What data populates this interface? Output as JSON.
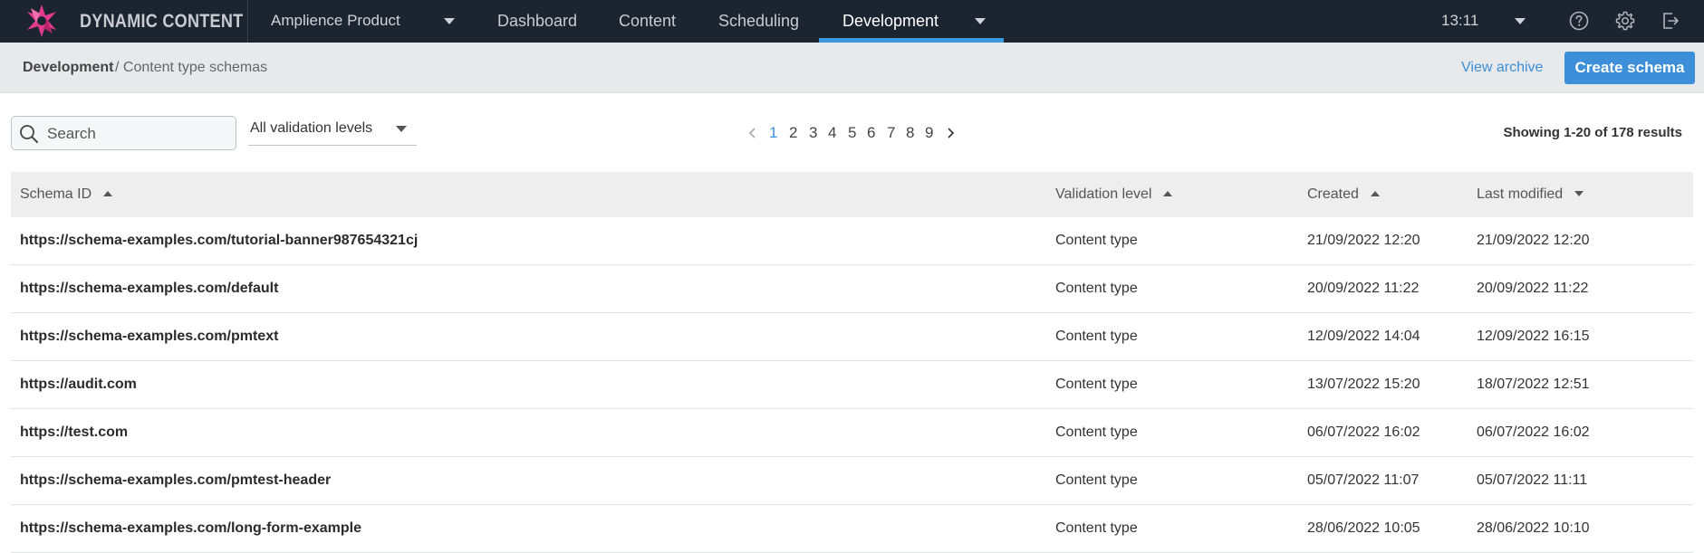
{
  "app": {
    "brand": "DYNAMIC CONTENT",
    "hub": "Amplience Product",
    "nav": [
      "Dashboard",
      "Content",
      "Scheduling",
      "Development"
    ],
    "active_nav": "Development",
    "time": "13:11",
    "icons": [
      "help-icon",
      "gear-icon",
      "logout-icon"
    ],
    "accent_color": "#3c8fd8"
  },
  "breadcrumb": {
    "root": "Development",
    "current": "/ Content type schemas"
  },
  "actions": {
    "view_archive": "View archive",
    "create_schema": "Create schema"
  },
  "filters": {
    "search_placeholder": "Search",
    "search_value": "",
    "validation_level": "All validation levels"
  },
  "pagination": {
    "pages": [
      "1",
      "2",
      "3",
      "4",
      "5",
      "6",
      "7",
      "8",
      "9"
    ],
    "current_page": "1",
    "showing": "Showing 1-20 of 178 results"
  },
  "table": {
    "headers": {
      "schema_id": "Schema ID",
      "validation_level": "Validation level",
      "created": "Created",
      "last_modified": "Last modified"
    },
    "rows": [
      {
        "id": "https://schema-examples.com/tutorial-banner987654321cj",
        "level": "Content type",
        "created": "21/09/2022 12:20",
        "modified": "21/09/2022 12:20"
      },
      {
        "id": "https://schema-examples.com/default",
        "level": "Content type",
        "created": "20/09/2022 11:22",
        "modified": "20/09/2022 11:22"
      },
      {
        "id": "https://schema-examples.com/pmtext",
        "level": "Content type",
        "created": "12/09/2022 14:04",
        "modified": "12/09/2022 16:15"
      },
      {
        "id": "https://audit.com",
        "level": "Content type",
        "created": "13/07/2022 15:20",
        "modified": "18/07/2022 12:51"
      },
      {
        "id": "https://test.com",
        "level": "Content type",
        "created": "06/07/2022 16:02",
        "modified": "06/07/2022 16:02"
      },
      {
        "id": "https://schema-examples.com/pmtest-header",
        "level": "Content type",
        "created": "05/07/2022 11:07",
        "modified": "05/07/2022 11:11"
      },
      {
        "id": "https://schema-examples.com/long-form-example",
        "level": "Content type",
        "created": "28/06/2022 10:05",
        "modified": "28/06/2022 10:10"
      }
    ]
  }
}
